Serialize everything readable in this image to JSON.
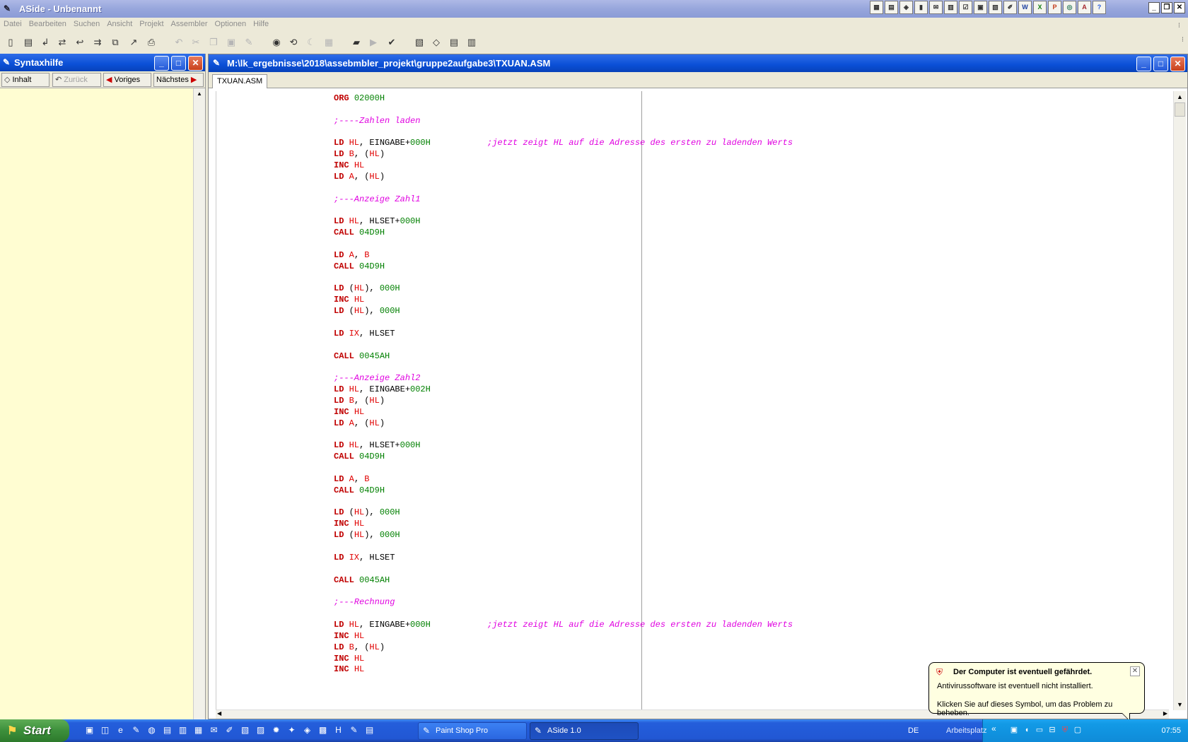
{
  "app": {
    "title": "ASide - Unbenannt"
  },
  "menu": [
    "Datei",
    "Bearbeiten",
    "Suchen",
    "Ansicht",
    "Projekt",
    "Assembler",
    "Optionen",
    "Hilfe"
  ],
  "syntax_panel": {
    "title": "Syntaxhilfe",
    "nav": {
      "contents": "Inhalt",
      "back": "Zurück",
      "prev": "Voriges",
      "next": "Nächstes"
    }
  },
  "editor": {
    "title": "M:\\lk_ergebnisse\\2018\\assebmbler_projekt\\gruppe2aufgabe3\\TXUAN.ASM",
    "tab": "TXUAN.ASM"
  },
  "code_lines": [
    [
      [
        "kw",
        "ORG"
      ],
      [
        "sym",
        " "
      ],
      [
        "num",
        "02000H"
      ]
    ],
    [],
    [
      [
        "cmt",
        ";----Zahlen laden"
      ]
    ],
    [],
    [
      [
        "kw",
        "LD"
      ],
      [
        "sym",
        " "
      ],
      [
        "reg",
        "HL"
      ],
      [
        "sym",
        ", EINGABE+"
      ],
      [
        "num",
        "000H"
      ]
    ],
    [
      [
        "kw",
        "LD"
      ],
      [
        "sym",
        " "
      ],
      [
        "reg",
        "B"
      ],
      [
        "sym",
        ", ("
      ],
      [
        "reg",
        "HL"
      ],
      [
        "sym",
        ")"
      ]
    ],
    [
      [
        "kw",
        "INC"
      ],
      [
        "sym",
        " "
      ],
      [
        "reg",
        "HL"
      ]
    ],
    [
      [
        "kw",
        "LD"
      ],
      [
        "sym",
        " "
      ],
      [
        "reg",
        "A"
      ],
      [
        "sym",
        ", ("
      ],
      [
        "reg",
        "HL"
      ],
      [
        "sym",
        ")"
      ]
    ],
    [],
    [
      [
        "cmt",
        ";---Anzeige Zahl1"
      ]
    ],
    [],
    [
      [
        "kw",
        "LD"
      ],
      [
        "sym",
        " "
      ],
      [
        "reg",
        "HL"
      ],
      [
        "sym",
        ", HLSET+"
      ],
      [
        "num",
        "000H"
      ]
    ],
    [
      [
        "kw",
        "CALL"
      ],
      [
        "sym",
        " "
      ],
      [
        "num",
        "04D9H"
      ]
    ],
    [],
    [
      [
        "kw",
        "LD"
      ],
      [
        "sym",
        " "
      ],
      [
        "reg",
        "A"
      ],
      [
        "sym",
        ", "
      ],
      [
        "reg",
        "B"
      ]
    ],
    [
      [
        "kw",
        "CALL"
      ],
      [
        "sym",
        " "
      ],
      [
        "num",
        "04D9H"
      ]
    ],
    [],
    [
      [
        "kw",
        "LD"
      ],
      [
        "sym",
        " ("
      ],
      [
        "reg",
        "HL"
      ],
      [
        "sym",
        "), "
      ],
      [
        "num",
        "000H"
      ]
    ],
    [
      [
        "kw",
        "INC"
      ],
      [
        "sym",
        " "
      ],
      [
        "reg",
        "HL"
      ]
    ],
    [
      [
        "kw",
        "LD"
      ],
      [
        "sym",
        " ("
      ],
      [
        "reg",
        "HL"
      ],
      [
        "sym",
        "), "
      ],
      [
        "num",
        "000H"
      ]
    ],
    [],
    [
      [
        "kw",
        "LD"
      ],
      [
        "sym",
        " "
      ],
      [
        "reg",
        "IX"
      ],
      [
        "sym",
        ", HLSET"
      ]
    ],
    [],
    [
      [
        "kw",
        "CALL"
      ],
      [
        "sym",
        " "
      ],
      [
        "num",
        "0045AH"
      ]
    ],
    [],
    [
      [
        "cmt",
        ";---Anzeige Zahl2"
      ]
    ],
    [
      [
        "kw",
        "LD"
      ],
      [
        "sym",
        " "
      ],
      [
        "reg",
        "HL"
      ],
      [
        "sym",
        ", EINGABE+"
      ],
      [
        "num",
        "002H"
      ]
    ],
    [
      [
        "kw",
        "LD"
      ],
      [
        "sym",
        " "
      ],
      [
        "reg",
        "B"
      ],
      [
        "sym",
        ", ("
      ],
      [
        "reg",
        "HL"
      ],
      [
        "sym",
        ")"
      ]
    ],
    [
      [
        "kw",
        "INC"
      ],
      [
        "sym",
        " "
      ],
      [
        "reg",
        "HL"
      ]
    ],
    [
      [
        "kw",
        "LD"
      ],
      [
        "sym",
        " "
      ],
      [
        "reg",
        "A"
      ],
      [
        "sym",
        ", ("
      ],
      [
        "reg",
        "HL"
      ],
      [
        "sym",
        ")"
      ]
    ],
    [],
    [
      [
        "kw",
        "LD"
      ],
      [
        "sym",
        " "
      ],
      [
        "reg",
        "HL"
      ],
      [
        "sym",
        ", HLSET+"
      ],
      [
        "num",
        "000H"
      ]
    ],
    [
      [
        "kw",
        "CALL"
      ],
      [
        "sym",
        " "
      ],
      [
        "num",
        "04D9H"
      ]
    ],
    [],
    [
      [
        "kw",
        "LD"
      ],
      [
        "sym",
        " "
      ],
      [
        "reg",
        "A"
      ],
      [
        "sym",
        ", "
      ],
      [
        "reg",
        "B"
      ]
    ],
    [
      [
        "kw",
        "CALL"
      ],
      [
        "sym",
        " "
      ],
      [
        "num",
        "04D9H"
      ]
    ],
    [],
    [
      [
        "kw",
        "LD"
      ],
      [
        "sym",
        " ("
      ],
      [
        "reg",
        "HL"
      ],
      [
        "sym",
        "), "
      ],
      [
        "num",
        "000H"
      ]
    ],
    [
      [
        "kw",
        "INC"
      ],
      [
        "sym",
        " "
      ],
      [
        "reg",
        "HL"
      ]
    ],
    [
      [
        "kw",
        "LD"
      ],
      [
        "sym",
        " ("
      ],
      [
        "reg",
        "HL"
      ],
      [
        "sym",
        "), "
      ],
      [
        "num",
        "000H"
      ]
    ],
    [],
    [
      [
        "kw",
        "LD"
      ],
      [
        "sym",
        " "
      ],
      [
        "reg",
        "IX"
      ],
      [
        "sym",
        ", HLSET"
      ]
    ],
    [],
    [
      [
        "kw",
        "CALL"
      ],
      [
        "sym",
        " "
      ],
      [
        "num",
        "0045AH"
      ]
    ],
    [],
    [
      [
        "cmt",
        ";---Rechnung"
      ]
    ],
    [],
    [
      [
        "kw",
        "LD"
      ],
      [
        "sym",
        " "
      ],
      [
        "reg",
        "HL"
      ],
      [
        "sym",
        ", EINGABE+"
      ],
      [
        "num",
        "000H"
      ]
    ],
    [
      [
        "kw",
        "INC"
      ],
      [
        "sym",
        " "
      ],
      [
        "reg",
        "HL"
      ]
    ],
    [
      [
        "kw",
        "LD"
      ],
      [
        "sym",
        " "
      ],
      [
        "reg",
        "B"
      ],
      [
        "sym",
        ", ("
      ],
      [
        "reg",
        "HL"
      ],
      [
        "sym",
        ")"
      ]
    ],
    [
      [
        "kw",
        "INC"
      ],
      [
        "sym",
        " "
      ],
      [
        "reg",
        "HL"
      ]
    ],
    [
      [
        "kw",
        "INC"
      ],
      [
        "sym",
        " "
      ],
      [
        "reg",
        "HL"
      ]
    ]
  ],
  "comments": [
    {
      "line": 4,
      "text": ";jetzt zeigt HL auf die Adresse des ersten zu ladenden Werts"
    },
    {
      "line": 47,
      "text": ";jetzt zeigt HL auf die Adresse des ersten zu ladenden Werts"
    }
  ],
  "taskbar": {
    "start": "Start",
    "tasks": [
      "Paint Shop Pro",
      "ASide 1.0"
    ],
    "language": "DE",
    "toolbar_label": "Arbeitsplatz",
    "clock": "07:55"
  },
  "balloon": {
    "title": "Der Computer ist eventuell gefährdet.",
    "line1": "Antivirussoftware ist eventuell nicht installiert.",
    "line2": "Klicken Sie auf dieses Symbol, um das Problem zu beheben."
  },
  "icons": {
    "toolbar": [
      "new-file-icon",
      "open-file-icon",
      "save-icon",
      "save-all-icon",
      "close-file-icon",
      "import-icon",
      "export-icon",
      "print-icon",
      "undo-icon",
      "cut-icon",
      "copy-icon",
      "paste-icon",
      "edit-icon",
      "find-icon",
      "replace-icon",
      "find-next-icon",
      "goto-icon",
      "open-project-icon",
      "run-icon",
      "check-icon",
      "assemble-icon",
      "build-icon",
      "options-icon",
      "help-icon"
    ]
  }
}
